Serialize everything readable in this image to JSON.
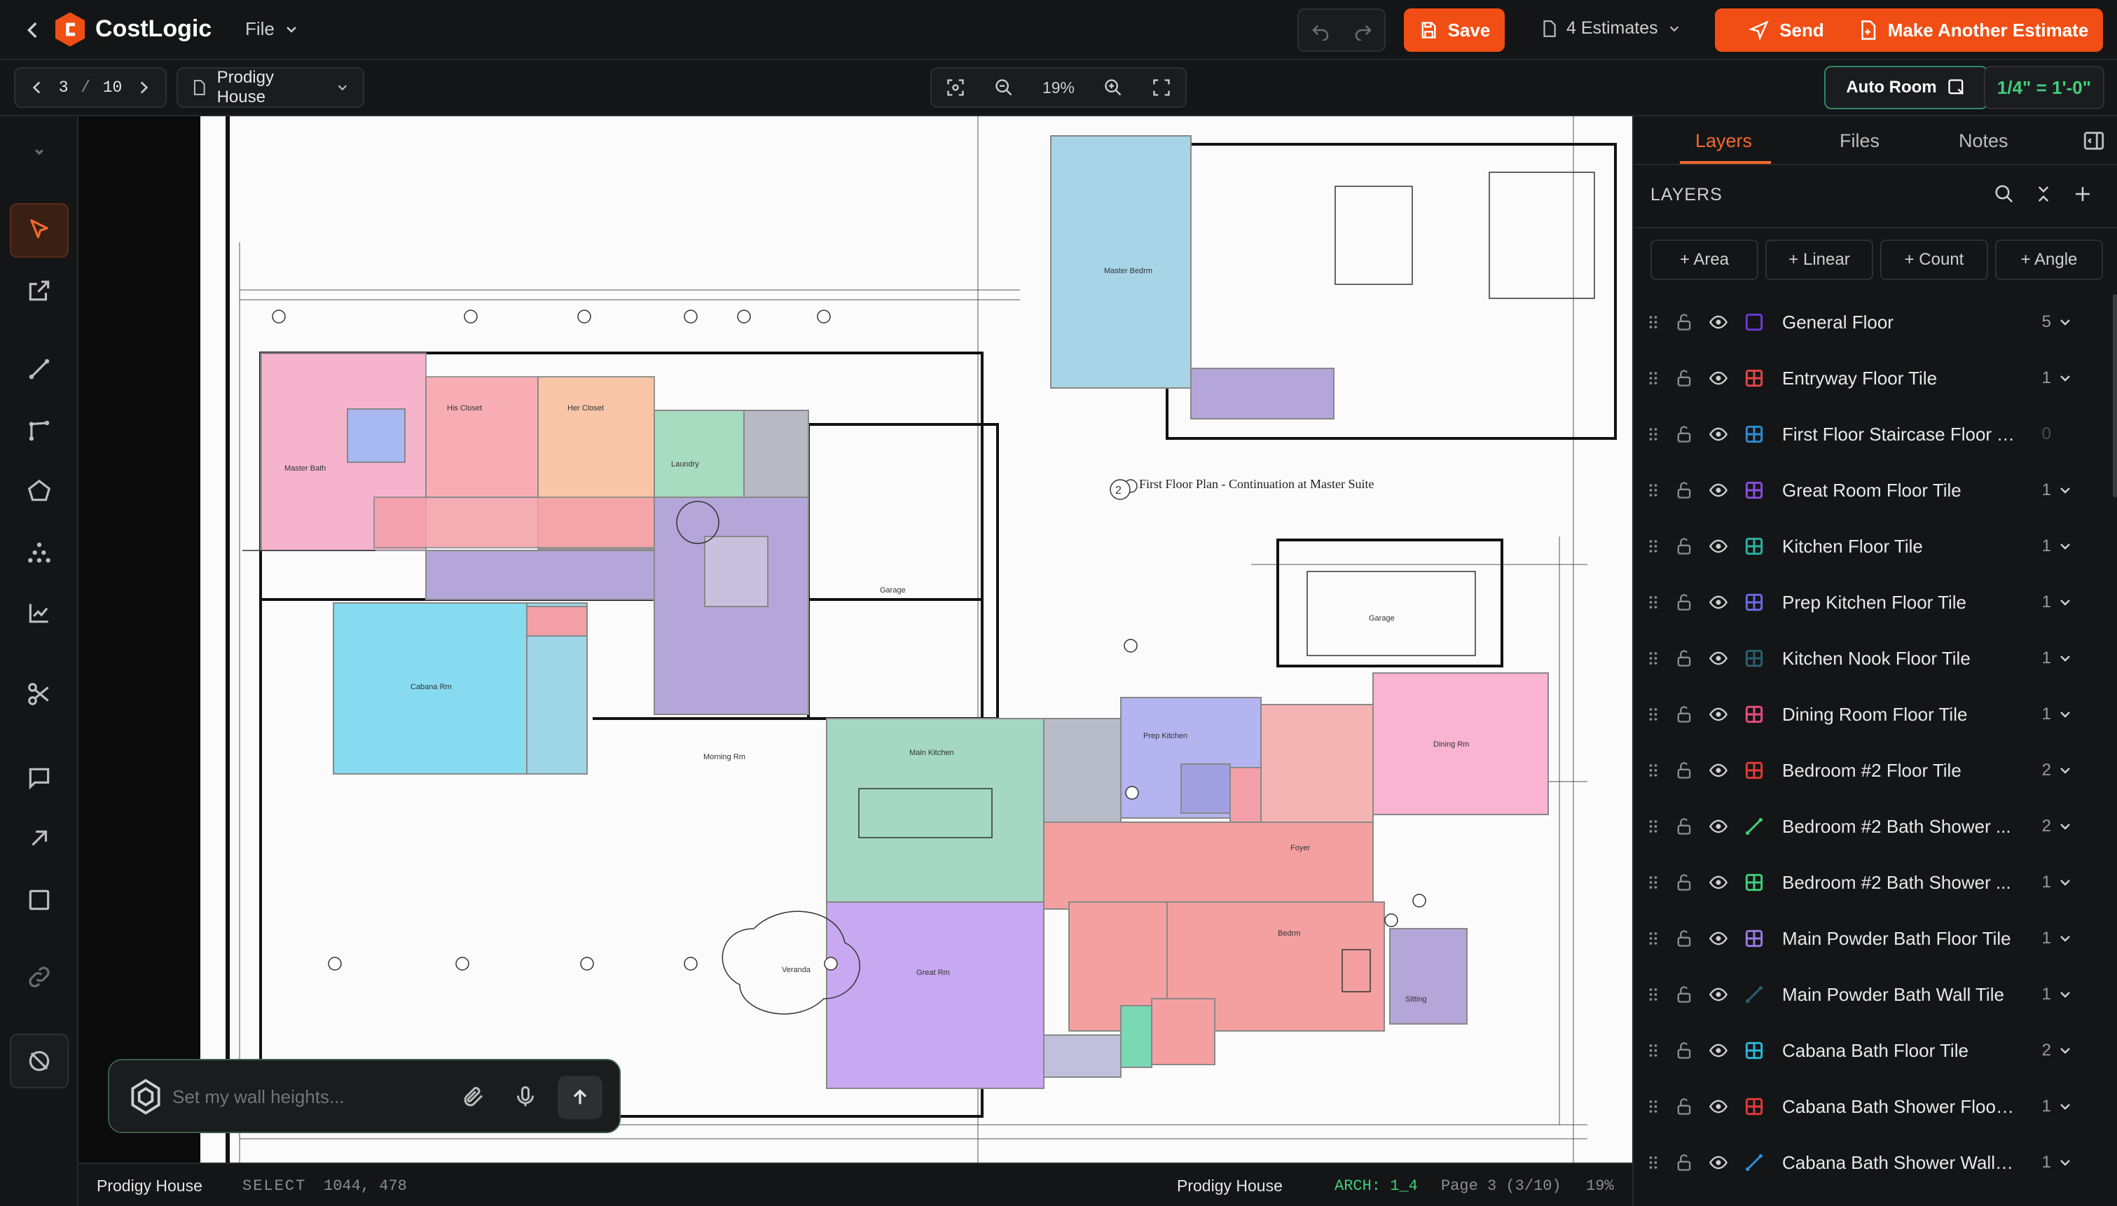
{
  "topbar": {
    "brand": "CostLogic",
    "file_menu": "File",
    "save_label": "Save",
    "estimates_label": "4 Estimates",
    "send_label": "Send",
    "make_another_label": "Make Another Estimate"
  },
  "nav": {
    "page_current": "3",
    "page_sep": "/",
    "page_total": "10",
    "project": "Prodigy House",
    "zoom": "19%",
    "auto_room": "Auto Room",
    "scale": "1/4\" = 1'-0\""
  },
  "panel": {
    "tabs": [
      "Layers",
      "Files",
      "Notes"
    ],
    "header": "LAYERS",
    "add_buttons": [
      "+ Area",
      "+ Linear",
      "+ Count",
      "+ Angle"
    ],
    "layers": [
      {
        "name": "General Floor",
        "count": "5",
        "color": "#6b3ad9",
        "icon": "square"
      },
      {
        "name": "Entryway Floor Tile",
        "count": "1",
        "color": "#e54646",
        "icon": "grid"
      },
      {
        "name": "First Floor Staircase Floor Tile",
        "count": "0",
        "color": "#2b8fd9",
        "icon": "grid"
      },
      {
        "name": "Great Room Floor Tile",
        "count": "1",
        "color": "#8a4fe0",
        "icon": "grid"
      },
      {
        "name": "Kitchen Floor Tile",
        "count": "1",
        "color": "#2ab3a0",
        "icon": "grid"
      },
      {
        "name": "Prep Kitchen Floor Tile",
        "count": "1",
        "color": "#6a6ae8",
        "icon": "grid"
      },
      {
        "name": "Kitchen Nook Floor Tile",
        "count": "1",
        "color": "#2a6070",
        "icon": "grid"
      },
      {
        "name": "Dining Room Floor Tile",
        "count": "1",
        "color": "#e84d7f",
        "icon": "grid"
      },
      {
        "name": "Bedroom #2 Floor Tile",
        "count": "2",
        "color": "#e23a3a",
        "icon": "grid"
      },
      {
        "name": "Bedroom #2 Bath Shower ...",
        "count": "2",
        "color": "#3fd07a",
        "icon": "line"
      },
      {
        "name": "Bedroom #2 Bath Shower ...",
        "count": "1",
        "color": "#3fd07a",
        "icon": "grid"
      },
      {
        "name": "Main Powder Bath Floor Tile",
        "count": "1",
        "color": "#9a7ae8",
        "icon": "grid"
      },
      {
        "name": "Main Powder Bath Wall Tile",
        "count": "1",
        "color": "#2a6070",
        "icon": "line"
      },
      {
        "name": "Cabana Bath Floor Tile",
        "count": "2",
        "color": "#2bb8d9",
        "icon": "grid"
      },
      {
        "name": "Cabana Bath Shower Floor ...",
        "count": "1",
        "color": "#e23a3a",
        "icon": "grid"
      },
      {
        "name": "Cabana Bath Shower Wall T...",
        "count": "1",
        "color": "#2b8fd9",
        "icon": "line"
      }
    ]
  },
  "chat": {
    "placeholder": "Set my wall heights..."
  },
  "status": {
    "project": "Prodigy House",
    "mode": "SELECT",
    "coords": "1044, 478",
    "project_right": "Prodigy House",
    "arch": "ARCH: 1_4",
    "page": "Page 3 (3/10)",
    "zoom": "19%"
  },
  "plan": {
    "caption": "First Floor Plan - Continuation at Master Suite",
    "caption_no": "2",
    "rooms": [
      "Master Bath",
      "His Closet",
      "Her Closet",
      "Laundry",
      "Cabana Rm",
      "Garage",
      "Main Kitchen",
      "Great Rm",
      "Dining Rm",
      "Bedrm",
      "Master Bedrm",
      "Garage",
      "Veranda",
      "Morning Rm",
      "Prep Kitchen",
      "Foyer",
      "Sitting"
    ]
  }
}
